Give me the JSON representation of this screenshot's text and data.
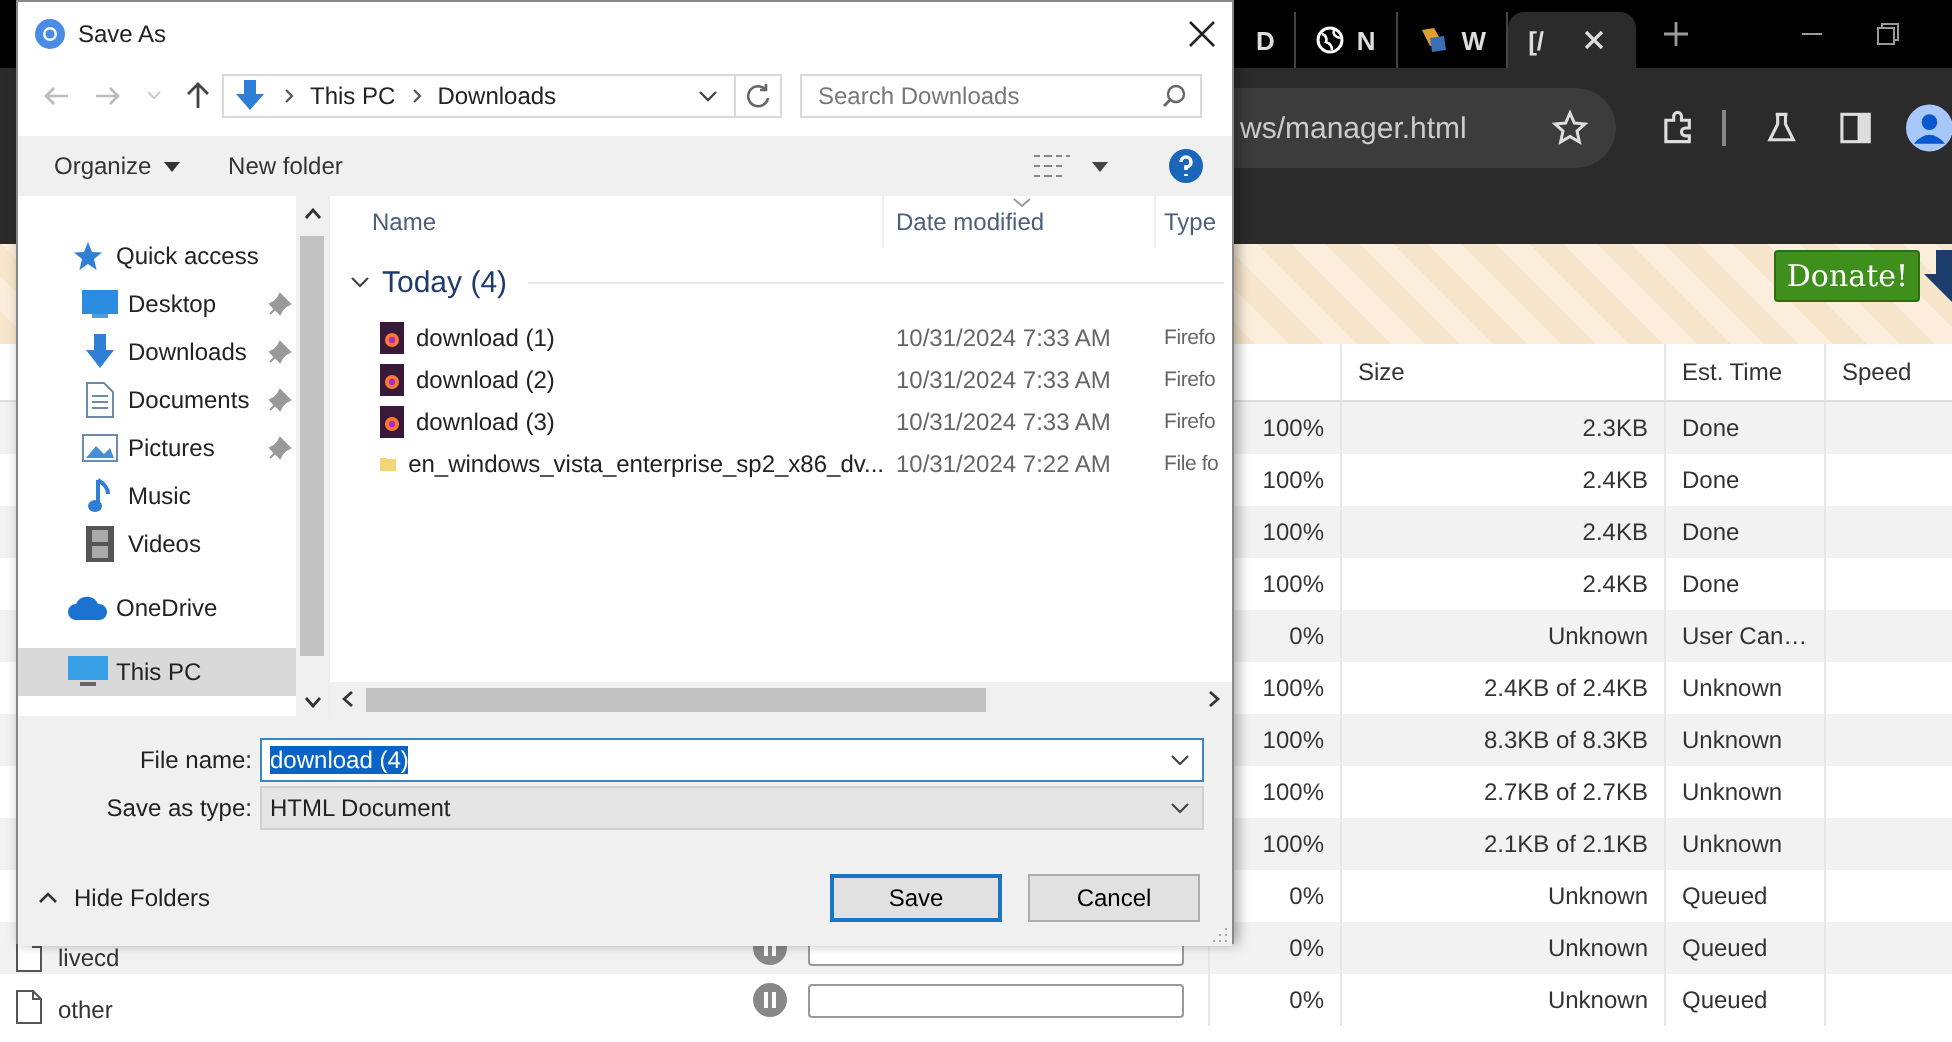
{
  "browser": {
    "tabs": [
      {
        "label": "D",
        "selected": false
      },
      {
        "label": "N",
        "selected": false
      },
      {
        "label": "W",
        "selected": false
      },
      {
        "label": "[/",
        "selected": true
      }
    ],
    "url": "ws/manager.html",
    "banner": {
      "donate": "Donate!"
    },
    "table": {
      "columns": [
        "Size",
        "Est. Time",
        "Speed"
      ],
      "rows": [
        {
          "percent": "100%",
          "size": "2.3KB",
          "est": "Done"
        },
        {
          "percent": "100%",
          "size": "2.4KB",
          "est": "Done"
        },
        {
          "percent": "100%",
          "size": "2.4KB",
          "est": "Done"
        },
        {
          "percent": "100%",
          "size": "2.4KB",
          "est": "Done"
        },
        {
          "percent": "0%",
          "size": "Unknown",
          "est": "User Can…"
        },
        {
          "percent": "100%",
          "size": "2.4KB of 2.4KB",
          "est": "Unknown"
        },
        {
          "percent": "100%",
          "size": "8.3KB of 8.3KB",
          "est": "Unknown"
        },
        {
          "percent": "100%",
          "size": "2.7KB of 2.7KB",
          "est": "Unknown"
        },
        {
          "percent": "100%",
          "size": "2.1KB of 2.1KB",
          "est": "Unknown"
        },
        {
          "percent": "0%",
          "size": "Unknown",
          "est": "Queued"
        },
        {
          "name": "livecd",
          "level": 0,
          "percent": "0%",
          "size": "Unknown",
          "est": "Queued"
        },
        {
          "name": "other",
          "level": 0,
          "percent": "0%",
          "size": "Unknown",
          "est": "Queued"
        }
      ]
    }
  },
  "dialog": {
    "title": "Save As",
    "breadcrumb": [
      "This PC",
      "Downloads"
    ],
    "search": {
      "placeholder": "Search Downloads"
    },
    "toolbar": [
      "Organize",
      "New folder"
    ],
    "nav": [
      {
        "label": "Quick access",
        "kind": "star",
        "selected": false,
        "children": [
          {
            "label": "Desktop",
            "kind": "desktop",
            "pinned": true,
            "selected": false
          },
          {
            "label": "Downloads",
            "kind": "download",
            "pinned": true,
            "selected": false
          },
          {
            "label": "Documents",
            "kind": "document",
            "pinned": true,
            "selected": false
          },
          {
            "label": "Pictures",
            "kind": "pictures",
            "pinned": true,
            "selected": false
          },
          {
            "label": "Music",
            "kind": "music",
            "pinned": false,
            "selected": false
          },
          {
            "label": "Videos",
            "kind": "video",
            "pinned": false,
            "selected": false
          }
        ]
      },
      {
        "label": "OneDrive",
        "kind": "cloud",
        "selected": false
      },
      {
        "label": "This PC",
        "kind": "pc",
        "selected": true
      }
    ],
    "columns": [
      "Name",
      "Date modified",
      "Type"
    ],
    "group": {
      "label": "Today (4)",
      "expanded": true
    },
    "files": [
      {
        "name": "download (1)",
        "kind": "document",
        "date": "10/31/2024 7:33 AM",
        "type": "Firefo"
      },
      {
        "name": "download (2)",
        "kind": "document",
        "date": "10/31/2024 7:33 AM",
        "type": "Firefo"
      },
      {
        "name": "download (3)",
        "kind": "document",
        "date": "10/31/2024 7:33 AM",
        "type": "Firefo"
      },
      {
        "name": "en_windows_vista_enterprise_sp2_x86_dv...",
        "kind": "folder",
        "date": "10/31/2024 7:22 AM",
        "type": "File fo"
      }
    ],
    "file_name_label": "File name:",
    "file_name": "download (4)",
    "type_label": "Save as type:",
    "save_type": "HTML Document",
    "hide_folders": "Hide Folders",
    "buttons": [
      "Save",
      "Cancel"
    ]
  }
}
